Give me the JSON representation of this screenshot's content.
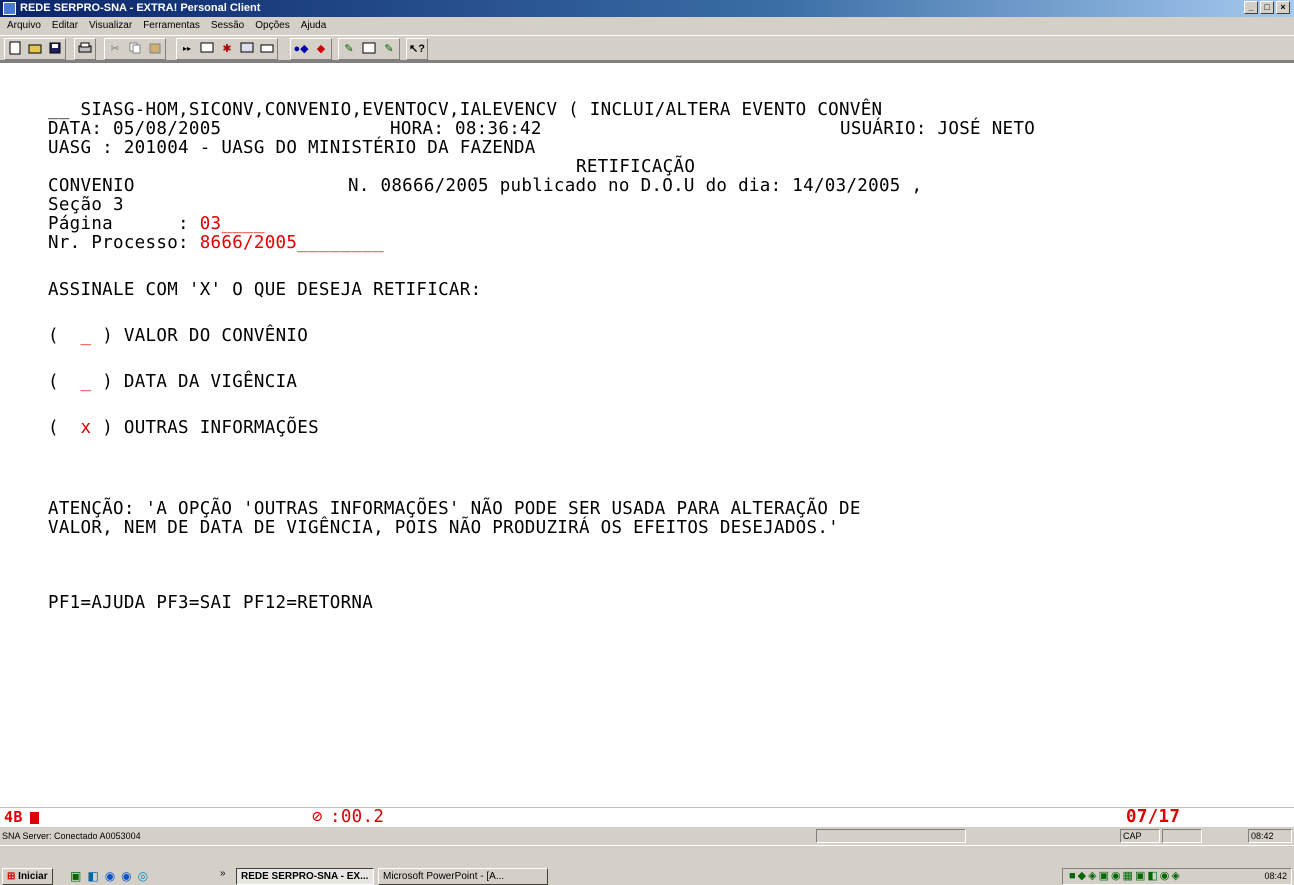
{
  "window": {
    "title": "REDE SERPRO-SNA - EXTRA! Personal Client",
    "controls": [
      "_",
      "ð",
      "×"
    ]
  },
  "menu": [
    "Arquivo",
    "Editar",
    "Visualizar",
    "Ferramentas",
    "Sessão",
    "Opções",
    "Ajuda"
  ],
  "toolbar_icons": [
    "new-icon",
    "open-icon",
    "save-icon",
    "print-icon",
    "cut-icon",
    "copy-icon",
    "paste-icon",
    "macro-icon",
    "screen-icon",
    "settings-icon",
    "display-icon",
    "keyboard-icon",
    "hotspot-icon",
    "color-icon",
    "edit-icon",
    "window-icon",
    "toolbar-icon",
    "help-icon"
  ],
  "terminal": {
    "line1": "__ SIASG-HOM,SICONV,CONVENIO,EVENTOCV,IALEVENCV ( INCLUI/ALTERA EVENTO CONVÊN",
    "data_label": "DATA: 05/08/2005",
    "hora_label": "HORA: 08:36:42",
    "usuario_label": "USUÁRIO: JOSÉ NETO",
    "uasg_line": "UASG : 201004 - UASG DO MINISTÉRIO DA FAZENDA",
    "retificacao": "RETIFICAÇÃO",
    "convenio_label": "CONVENIO",
    "convenio_text": "N. 08666/2005 publicado no D.O.U do dia: 14/03/2005 ,",
    "secao": "Seção 3",
    "pagina_label": "Página      : ",
    "pagina_value": "03____",
    "processo_label": "Nr. Processo: ",
    "processo_value": "8666/2005________",
    "assinale": "ASSINALE COM 'X' O QUE DESEJA RETIFICAR:",
    "options": [
      {
        "mark": "_",
        "label": ") VALOR DO CONVÊNIO"
      },
      {
        "mark": "_",
        "label": ") DATA DA VIGÊNCIA"
      },
      {
        "mark": "x",
        "label": ") OUTRAS INFORMAÇÕES"
      }
    ],
    "atencao1": "ATENÇÃO: 'A OPÇÃO 'OUTRAS INFORMAÇÕES' NÃO PODE SER USADA PARA ALTERAÇÃO DE",
    "atencao2": "VALOR, NEM DE DATA DE VIGÊNCIA, POIS NÃO PRODUZIRÁ OS EFEITOS DESEJADOS.'",
    "pf_keys": "PF1=AJUDA PF3=SAI PF12=RETORNA"
  },
  "statusline": {
    "left": "4B",
    "timer": ":00.2",
    "cursor": "07/17"
  },
  "connbar": {
    "server": "SNA Server: Conectado A0053004",
    "cap": "CAP",
    "time": "08:42"
  },
  "taskbar": {
    "start": "Iniciar",
    "chevron": "»",
    "tasks": [
      "REDE SERPRO-SNA - EX...",
      "Microsoft PowerPoint - [A..."
    ],
    "clock": "08:42"
  },
  "colors": {
    "field_red": "#e00000",
    "title_blue": "#0a246a",
    "chrome": "#d4d0c8"
  }
}
